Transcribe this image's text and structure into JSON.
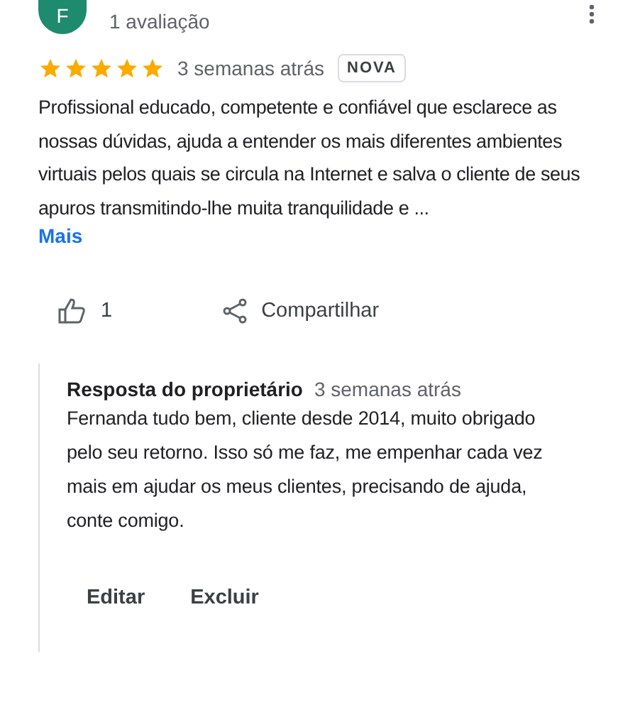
{
  "review": {
    "avatar_letter": "F",
    "reviewer_meta": "1 avaliação",
    "stars": 5,
    "time": "3 semanas atrás",
    "badge": "NOVA",
    "text": "Profissional educado, competente e confiável que esclarece as nossas dúvidas, ajuda a entender os mais diferentes ambientes virtuais pelos quais se circula na Internet e salva o cliente de seus apuros transmitindo-lhe muita tranquilidade e ...",
    "more": "Mais",
    "likes": "1",
    "share": "Compartilhar"
  },
  "reply": {
    "title": "Resposta do proprietário",
    "time": "3 semanas atrás",
    "text": "Fernanda tudo bem, cliente desde 2014, muito obrigado pelo seu retorno. Isso só me faz, me empenhar cada vez mais em ajudar os meus clientes, precisando de ajuda, conte comigo.",
    "buttons": [
      "Editar",
      "Excluir"
    ]
  }
}
